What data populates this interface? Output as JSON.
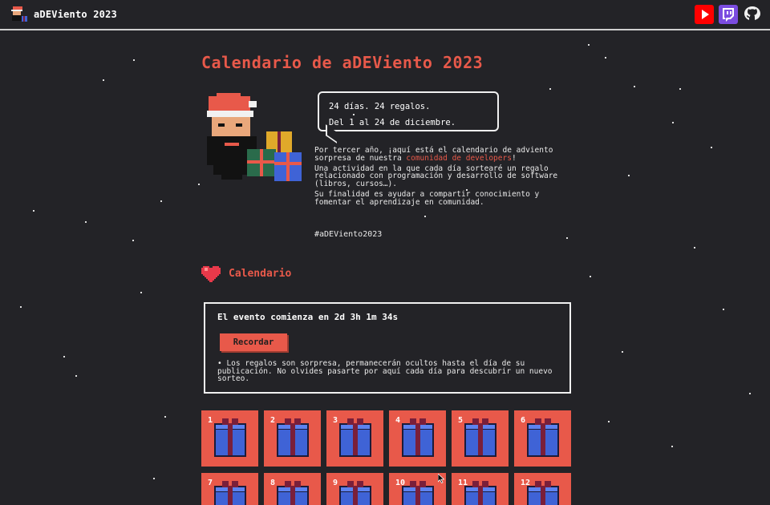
{
  "header": {
    "title": "aDEViento 2023",
    "socials": [
      {
        "name": "youtube-icon"
      },
      {
        "name": "twitch-icon"
      },
      {
        "name": "github-icon"
      }
    ]
  },
  "main": {
    "title": "Calendario de aDEViento 2023",
    "speech": {
      "line1": "24 días. 24 regalos.",
      "line2": "Del 1 al 24 de diciembre."
    },
    "intro": {
      "p1_before": "Por tercer año, ¡aquí está el calendario de adviento sorpresa de nuestra ",
      "p1_link": "comunidad de developers",
      "p1_after": "!",
      "p2": "Una actividad en la que cada día sortearé un regalo relacionado con programación y desarrollo de software (libros, cursos…).",
      "p3": "Su finalidad es ayudar a compartir conocimiento y fomentar el aprendizaje en comunidad."
    },
    "hashtag": "#aDEViento2023"
  },
  "calendar": {
    "title": "Calendario",
    "event_text": "El evento comienza en 2d 3h 1m 34s",
    "remind_label": "Recordar",
    "note": "• Los regalos son sorpresa, permanecerán ocultos hasta el día de su publicación. No olvides pasarte por aquí cada día para descubrir un nuevo sorteo.",
    "days": [
      "1",
      "2",
      "3",
      "4",
      "5",
      "6",
      "7",
      "8",
      "9",
      "10",
      "11",
      "12"
    ]
  },
  "colors": {
    "accent": "#e8594a",
    "background": "#232327",
    "gift_blue": "#3f63d6",
    "gift_ribbon": "#7a1f3a"
  }
}
